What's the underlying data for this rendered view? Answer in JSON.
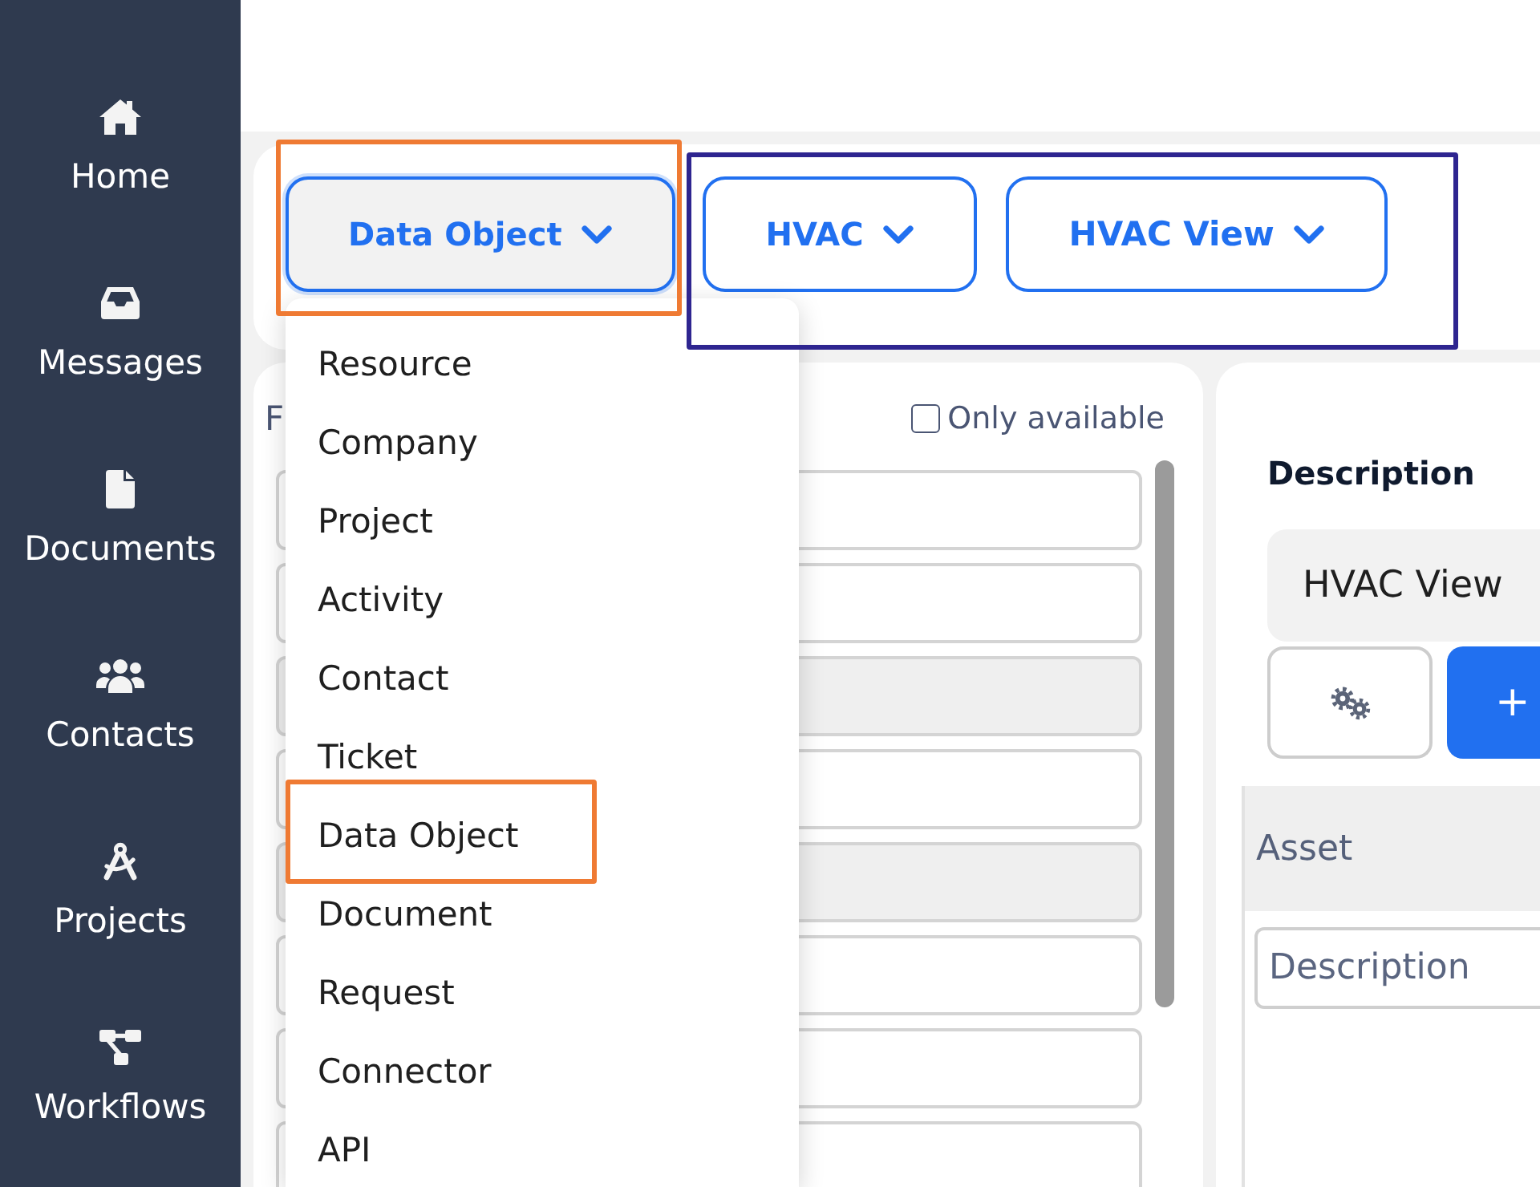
{
  "sidebar": {
    "items": [
      {
        "label": "Home"
      },
      {
        "label": "Messages"
      },
      {
        "label": "Documents"
      },
      {
        "label": "Contacts"
      },
      {
        "label": "Projects"
      },
      {
        "label": "Workflows"
      }
    ]
  },
  "toolbar": {
    "groups": [
      {
        "color": "#ef7a33",
        "dropdowns": [
          {
            "label": "Data Object",
            "expanded": true
          }
        ]
      },
      {
        "color": "#2e2590",
        "dropdowns": [
          {
            "label": "HVAC",
            "expanded": false
          },
          {
            "label": "HVAC View",
            "expanded": false
          }
        ]
      }
    ]
  },
  "menu": {
    "items": [
      {
        "label": "Resource",
        "selected": false
      },
      {
        "label": "Company",
        "selected": false
      },
      {
        "label": "Project",
        "selected": false
      },
      {
        "label": "Activity",
        "selected": false
      },
      {
        "label": "Contact",
        "selected": false
      },
      {
        "label": "Ticket",
        "selected": false
      },
      {
        "label": "Data Object",
        "selected": true
      },
      {
        "label": "Document",
        "selected": false
      },
      {
        "label": "Request",
        "selected": false
      },
      {
        "label": "Connector",
        "selected": false
      },
      {
        "label": "API",
        "selected": false
      }
    ]
  },
  "list_panel": {
    "title": "F",
    "filter": {
      "label": "Only available",
      "checked": false
    },
    "fields": [
      {
        "disabled": false
      },
      {
        "disabled": false
      },
      {
        "disabled": true
      },
      {
        "disabled": false
      },
      {
        "disabled": true
      },
      {
        "disabled": false
      },
      {
        "disabled": false
      },
      {
        "disabled": false
      }
    ]
  },
  "detail_panel": {
    "heading": "Description",
    "name_value": "HVAC View",
    "add_button": "+",
    "table": {
      "columns": [
        "Asset"
      ],
      "filter_placeholder": "Description"
    }
  }
}
